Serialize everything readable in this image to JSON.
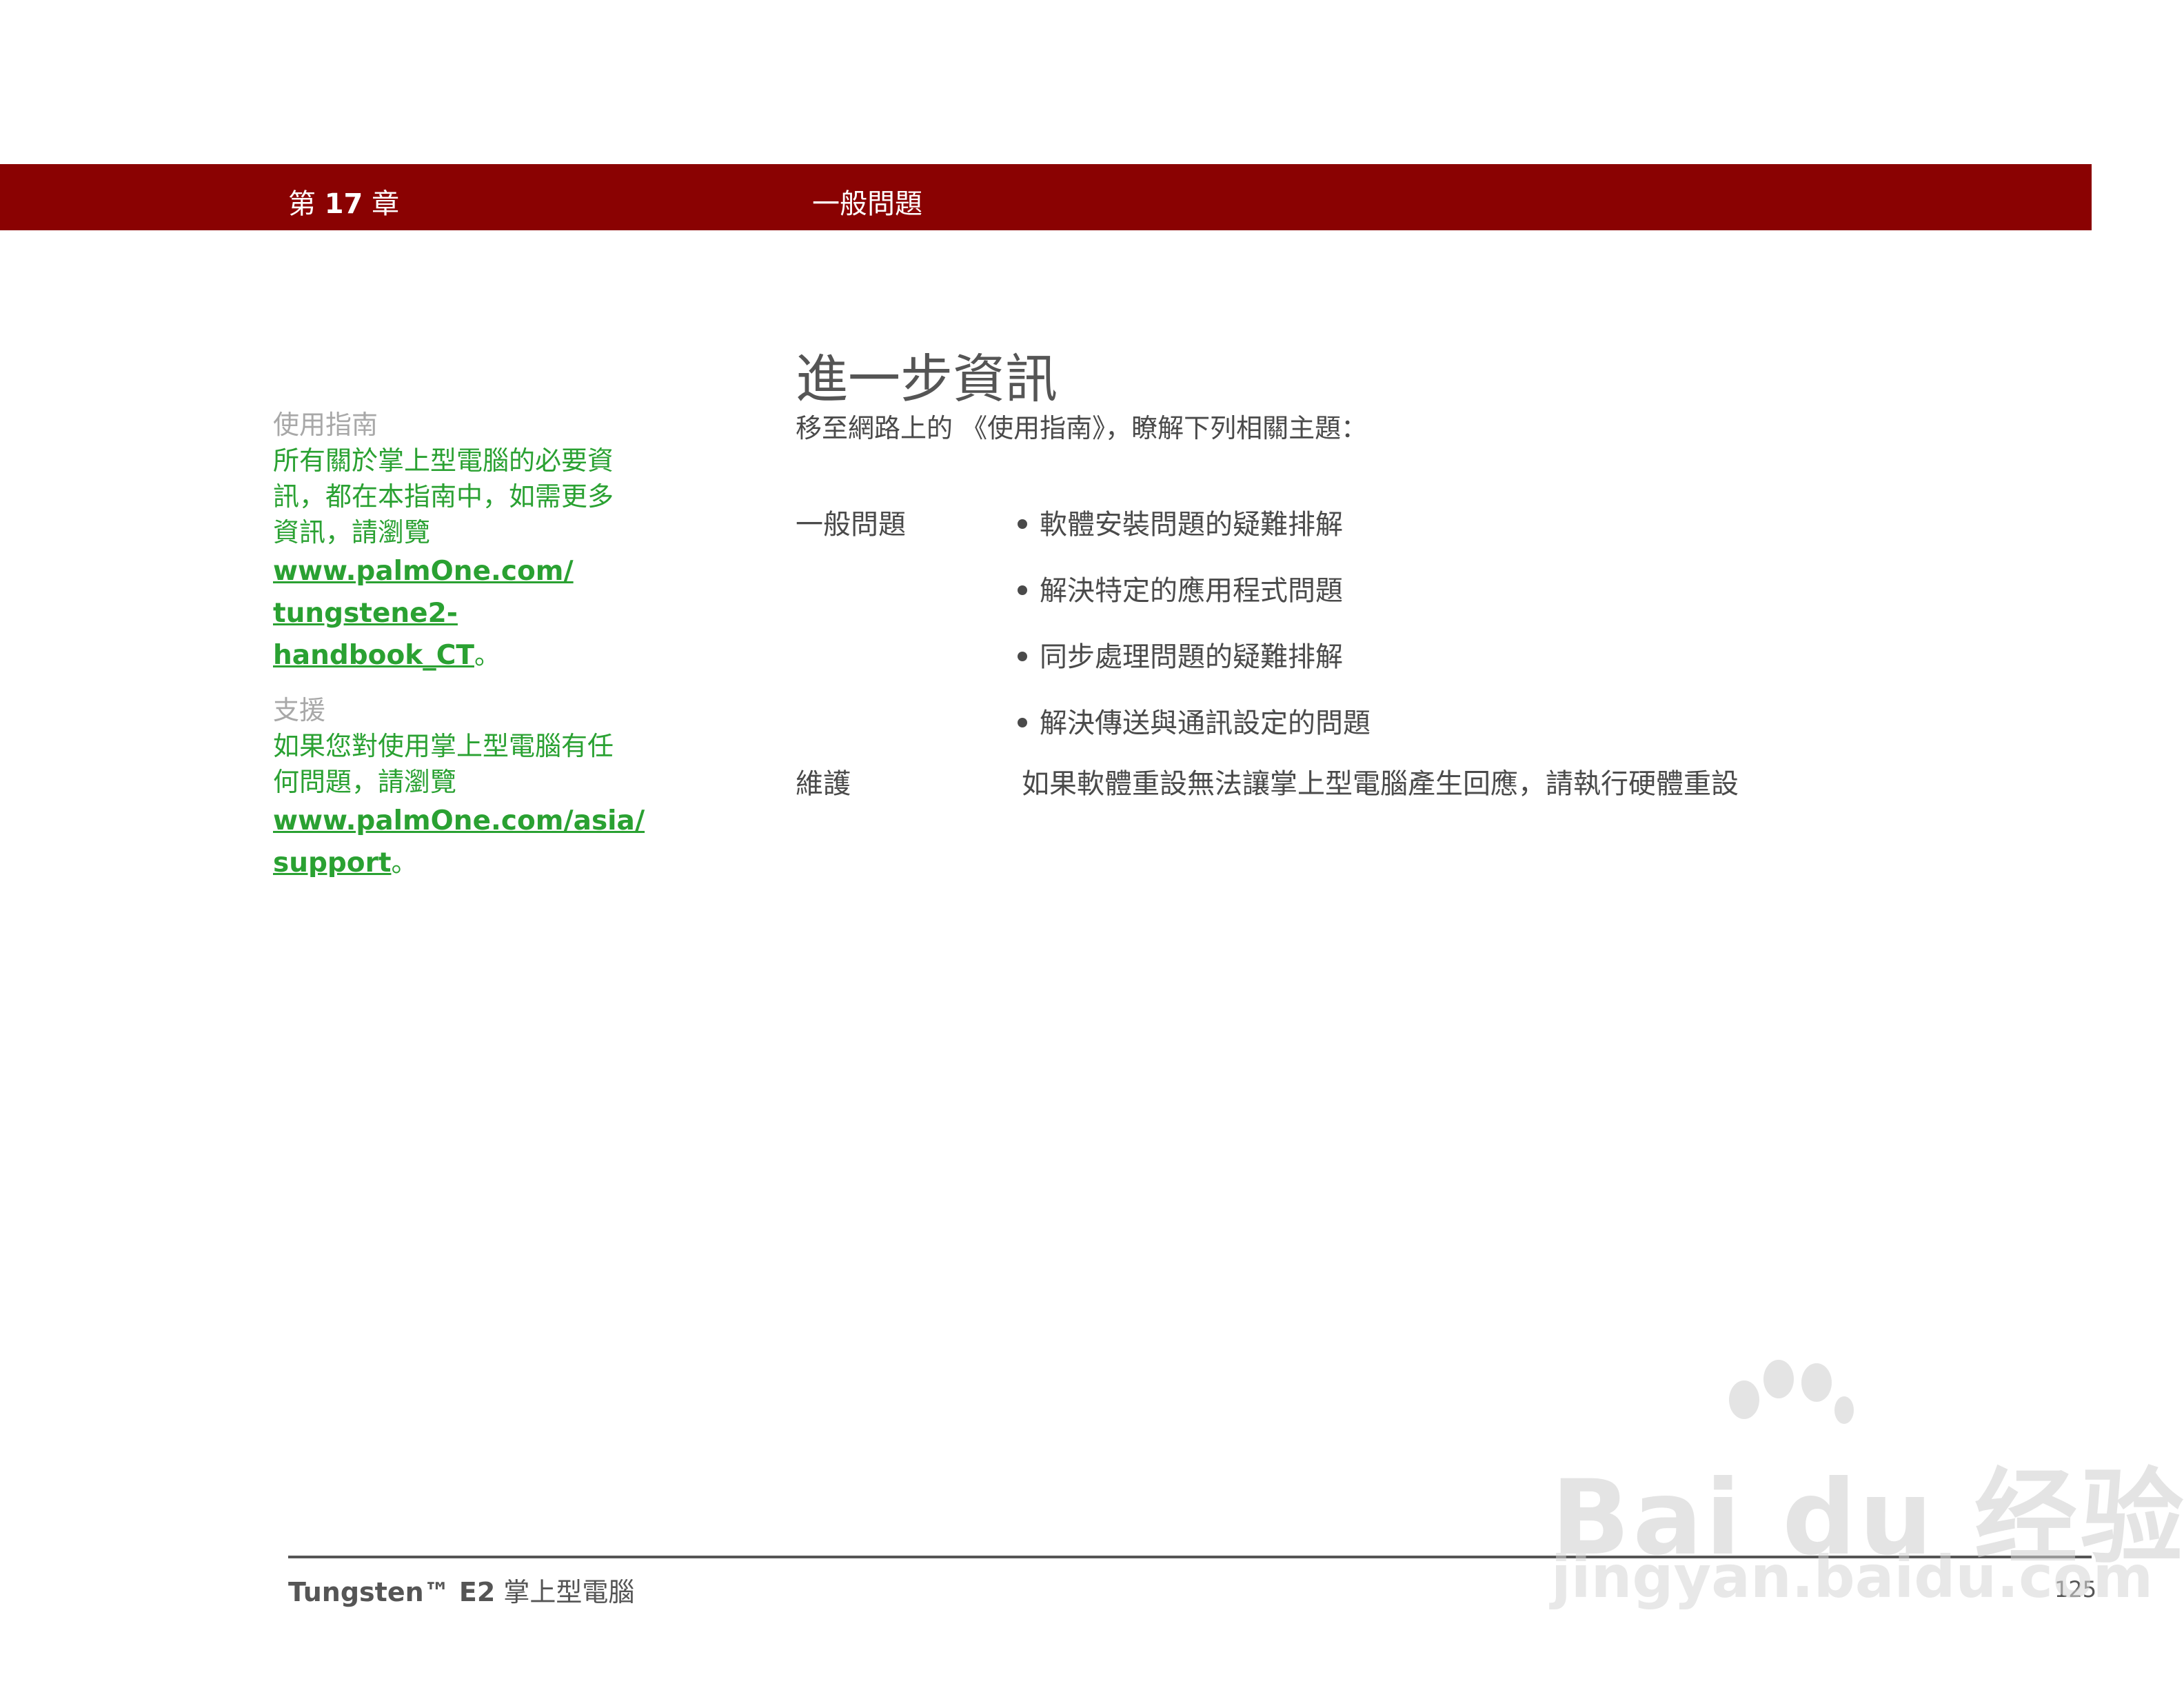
{
  "header": {
    "chapter_prefix": "第",
    "chapter_number": "17",
    "chapter_suffix": "章",
    "chapter_title": "一般問題"
  },
  "sidebar": {
    "guide": {
      "heading": "使用指南",
      "text_line1": "所有關於掌上型電腦的必要資",
      "text_line2": "訊，都在本指南中，如需更多",
      "text_line3": "資訊，請瀏覽",
      "link_line1": "www.palmOne.com/",
      "link_line2": "tungstene2-handbook_CT",
      "end_punct": "。"
    },
    "support": {
      "heading": "支援",
      "text_line1": "如果您對使用掌上型電腦有任",
      "text_line2": "何問題，請瀏覽",
      "link_line1": "www.palmOne.com/asia/",
      "link_line2": "support",
      "end_punct": "。"
    }
  },
  "main": {
    "title": "進一步資訊",
    "intro": "移至網路上的 《使用指南》，瞭解下列相關主題：",
    "rows": [
      {
        "label": "一般問題",
        "items": [
          "軟體安裝問題的疑難排解",
          "解決特定的應用程式問題",
          "同步處理問題的疑難排解",
          "解決傳送與通訊設定的問題"
        ]
      },
      {
        "label": "維護",
        "text": "如果軟體重設無法讓掌上型電腦產生回應，請執行硬體重設"
      }
    ]
  },
  "footer": {
    "product": "Tungsten™ E2",
    "suffix": "掌上型電腦",
    "page_number": "125"
  },
  "watermark": {
    "logo_text": "Bai du 经验",
    "url": "jingyan.baidu.com"
  }
}
